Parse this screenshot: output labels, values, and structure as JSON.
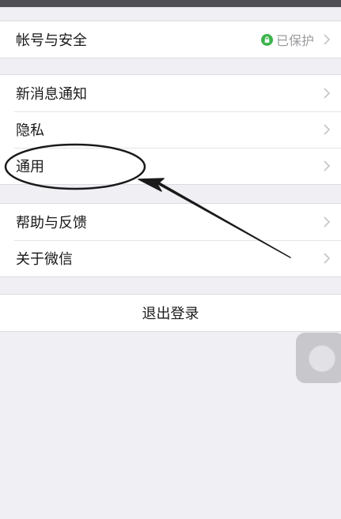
{
  "groups": {
    "account": {
      "label": "帐号与安全",
      "status": "已保护",
      "status_color": "#3cb44b"
    },
    "general": [
      {
        "label": "新消息通知"
      },
      {
        "label": "隐私"
      },
      {
        "label": "通用"
      }
    ],
    "about": [
      {
        "label": "帮助与反馈"
      },
      {
        "label": "关于微信"
      }
    ],
    "logout": {
      "label": "退出登录"
    }
  },
  "icons": {
    "lock": "lock-icon",
    "chevron": "chevron-right-icon"
  }
}
